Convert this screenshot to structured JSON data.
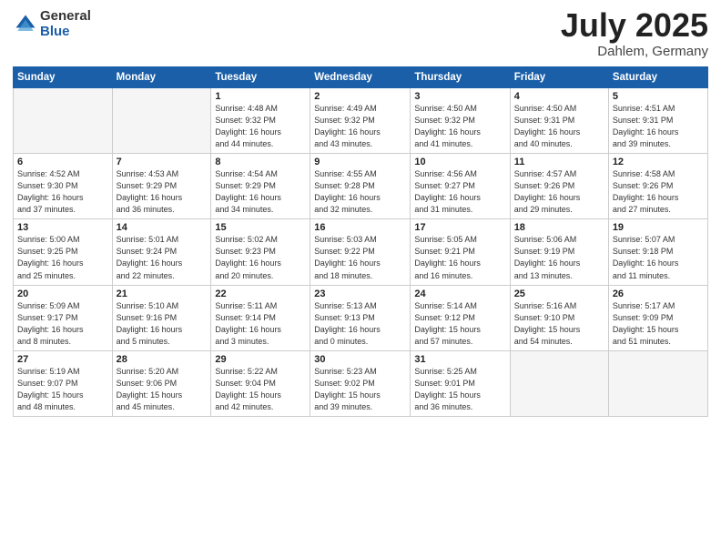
{
  "header": {
    "logo_general": "General",
    "logo_blue": "Blue",
    "title": "July 2025",
    "location": "Dahlem, Germany"
  },
  "days_of_week": [
    "Sunday",
    "Monday",
    "Tuesday",
    "Wednesday",
    "Thursday",
    "Friday",
    "Saturday"
  ],
  "weeks": [
    [
      {
        "day": "",
        "sunrise": "",
        "sunset": "",
        "daylight": ""
      },
      {
        "day": "",
        "sunrise": "",
        "sunset": "",
        "daylight": ""
      },
      {
        "day": "1",
        "sunrise": "Sunrise: 4:48 AM",
        "sunset": "Sunset: 9:32 PM",
        "daylight": "Daylight: 16 hours and 44 minutes."
      },
      {
        "day": "2",
        "sunrise": "Sunrise: 4:49 AM",
        "sunset": "Sunset: 9:32 PM",
        "daylight": "Daylight: 16 hours and 43 minutes."
      },
      {
        "day": "3",
        "sunrise": "Sunrise: 4:50 AM",
        "sunset": "Sunset: 9:32 PM",
        "daylight": "Daylight: 16 hours and 41 minutes."
      },
      {
        "day": "4",
        "sunrise": "Sunrise: 4:50 AM",
        "sunset": "Sunset: 9:31 PM",
        "daylight": "Daylight: 16 hours and 40 minutes."
      },
      {
        "day": "5",
        "sunrise": "Sunrise: 4:51 AM",
        "sunset": "Sunset: 9:31 PM",
        "daylight": "Daylight: 16 hours and 39 minutes."
      }
    ],
    [
      {
        "day": "6",
        "sunrise": "Sunrise: 4:52 AM",
        "sunset": "Sunset: 9:30 PM",
        "daylight": "Daylight: 16 hours and 37 minutes."
      },
      {
        "day": "7",
        "sunrise": "Sunrise: 4:53 AM",
        "sunset": "Sunset: 9:29 PM",
        "daylight": "Daylight: 16 hours and 36 minutes."
      },
      {
        "day": "8",
        "sunrise": "Sunrise: 4:54 AM",
        "sunset": "Sunset: 9:29 PM",
        "daylight": "Daylight: 16 hours and 34 minutes."
      },
      {
        "day": "9",
        "sunrise": "Sunrise: 4:55 AM",
        "sunset": "Sunset: 9:28 PM",
        "daylight": "Daylight: 16 hours and 32 minutes."
      },
      {
        "day": "10",
        "sunrise": "Sunrise: 4:56 AM",
        "sunset": "Sunset: 9:27 PM",
        "daylight": "Daylight: 16 hours and 31 minutes."
      },
      {
        "day": "11",
        "sunrise": "Sunrise: 4:57 AM",
        "sunset": "Sunset: 9:26 PM",
        "daylight": "Daylight: 16 hours and 29 minutes."
      },
      {
        "day": "12",
        "sunrise": "Sunrise: 4:58 AM",
        "sunset": "Sunset: 9:26 PM",
        "daylight": "Daylight: 16 hours and 27 minutes."
      }
    ],
    [
      {
        "day": "13",
        "sunrise": "Sunrise: 5:00 AM",
        "sunset": "Sunset: 9:25 PM",
        "daylight": "Daylight: 16 hours and 25 minutes."
      },
      {
        "day": "14",
        "sunrise": "Sunrise: 5:01 AM",
        "sunset": "Sunset: 9:24 PM",
        "daylight": "Daylight: 16 hours and 22 minutes."
      },
      {
        "day": "15",
        "sunrise": "Sunrise: 5:02 AM",
        "sunset": "Sunset: 9:23 PM",
        "daylight": "Daylight: 16 hours and 20 minutes."
      },
      {
        "day": "16",
        "sunrise": "Sunrise: 5:03 AM",
        "sunset": "Sunset: 9:22 PM",
        "daylight": "Daylight: 16 hours and 18 minutes."
      },
      {
        "day": "17",
        "sunrise": "Sunrise: 5:05 AM",
        "sunset": "Sunset: 9:21 PM",
        "daylight": "Daylight: 16 hours and 16 minutes."
      },
      {
        "day": "18",
        "sunrise": "Sunrise: 5:06 AM",
        "sunset": "Sunset: 9:19 PM",
        "daylight": "Daylight: 16 hours and 13 minutes."
      },
      {
        "day": "19",
        "sunrise": "Sunrise: 5:07 AM",
        "sunset": "Sunset: 9:18 PM",
        "daylight": "Daylight: 16 hours and 11 minutes."
      }
    ],
    [
      {
        "day": "20",
        "sunrise": "Sunrise: 5:09 AM",
        "sunset": "Sunset: 9:17 PM",
        "daylight": "Daylight: 16 hours and 8 minutes."
      },
      {
        "day": "21",
        "sunrise": "Sunrise: 5:10 AM",
        "sunset": "Sunset: 9:16 PM",
        "daylight": "Daylight: 16 hours and 5 minutes."
      },
      {
        "day": "22",
        "sunrise": "Sunrise: 5:11 AM",
        "sunset": "Sunset: 9:14 PM",
        "daylight": "Daylight: 16 hours and 3 minutes."
      },
      {
        "day": "23",
        "sunrise": "Sunrise: 5:13 AM",
        "sunset": "Sunset: 9:13 PM",
        "daylight": "Daylight: 16 hours and 0 minutes."
      },
      {
        "day": "24",
        "sunrise": "Sunrise: 5:14 AM",
        "sunset": "Sunset: 9:12 PM",
        "daylight": "Daylight: 15 hours and 57 minutes."
      },
      {
        "day": "25",
        "sunrise": "Sunrise: 5:16 AM",
        "sunset": "Sunset: 9:10 PM",
        "daylight": "Daylight: 15 hours and 54 minutes."
      },
      {
        "day": "26",
        "sunrise": "Sunrise: 5:17 AM",
        "sunset": "Sunset: 9:09 PM",
        "daylight": "Daylight: 15 hours and 51 minutes."
      }
    ],
    [
      {
        "day": "27",
        "sunrise": "Sunrise: 5:19 AM",
        "sunset": "Sunset: 9:07 PM",
        "daylight": "Daylight: 15 hours and 48 minutes."
      },
      {
        "day": "28",
        "sunrise": "Sunrise: 5:20 AM",
        "sunset": "Sunset: 9:06 PM",
        "daylight": "Daylight: 15 hours and 45 minutes."
      },
      {
        "day": "29",
        "sunrise": "Sunrise: 5:22 AM",
        "sunset": "Sunset: 9:04 PM",
        "daylight": "Daylight: 15 hours and 42 minutes."
      },
      {
        "day": "30",
        "sunrise": "Sunrise: 5:23 AM",
        "sunset": "Sunset: 9:02 PM",
        "daylight": "Daylight: 15 hours and 39 minutes."
      },
      {
        "day": "31",
        "sunrise": "Sunrise: 5:25 AM",
        "sunset": "Sunset: 9:01 PM",
        "daylight": "Daylight: 15 hours and 36 minutes."
      },
      {
        "day": "",
        "sunrise": "",
        "sunset": "",
        "daylight": ""
      },
      {
        "day": "",
        "sunrise": "",
        "sunset": "",
        "daylight": ""
      }
    ]
  ]
}
